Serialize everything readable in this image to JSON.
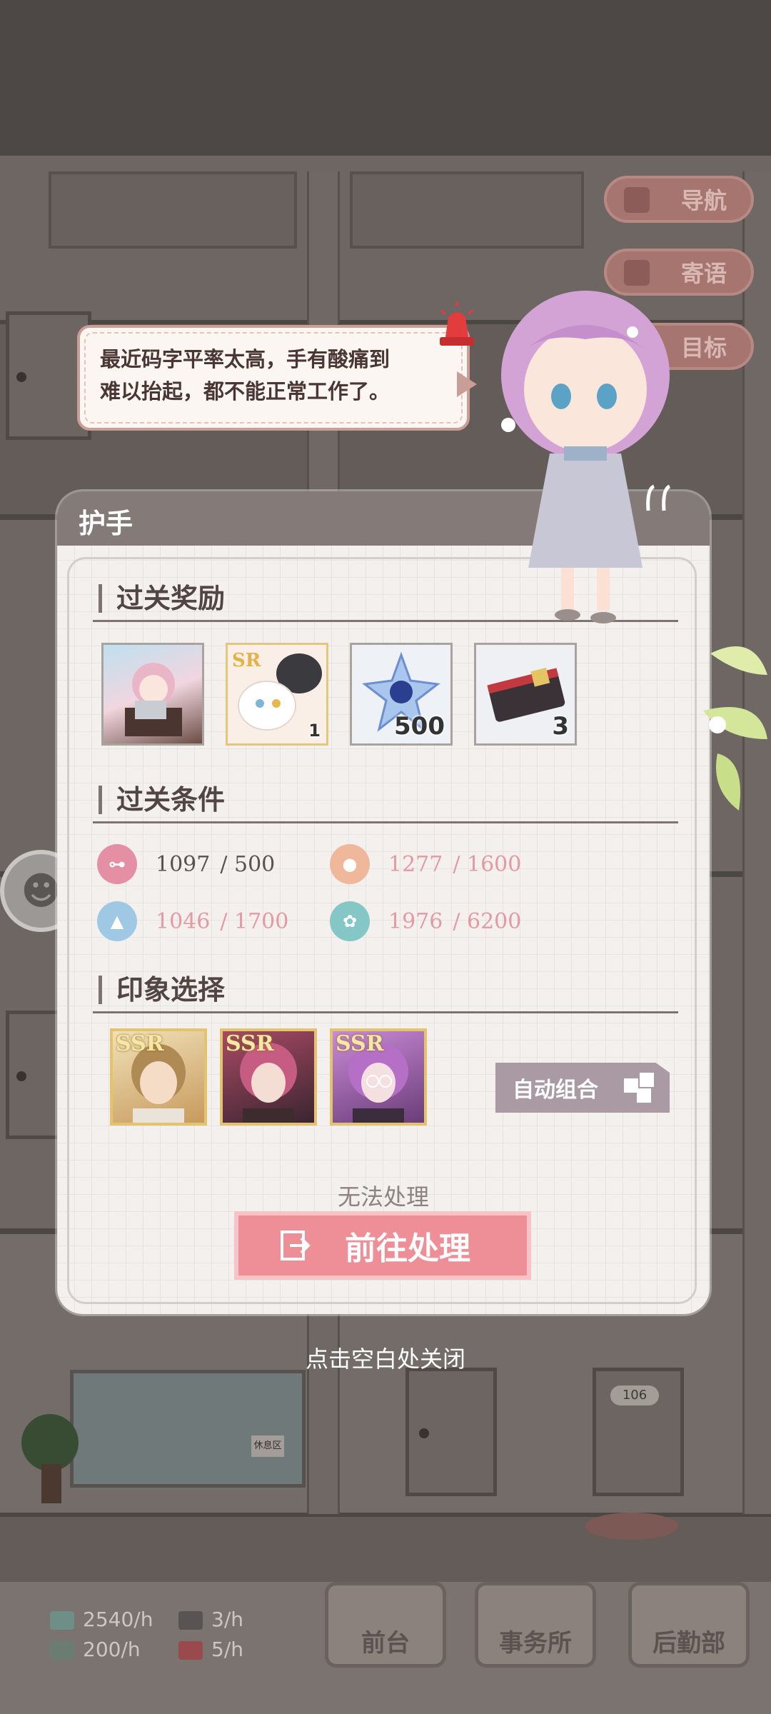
{
  "speech": {
    "line1": "最近码字平率太高，手有酸痛到",
    "line2": "难以抬起，都不能正常工作了。"
  },
  "side_buttons": [
    {
      "label": "导航",
      "icon": "map-icon"
    },
    {
      "label": "寄语",
      "icon": "notebook-icon"
    },
    {
      "label": "目标",
      "icon": "target-icon"
    }
  ],
  "dialog": {
    "title": "护手",
    "rewards_title": "过关奖励",
    "rewards": [
      {
        "name": "scene-card",
        "count": ""
      },
      {
        "name": "sr-cat-card",
        "count": "1"
      },
      {
        "name": "blue-crystal",
        "count": "500"
      },
      {
        "name": "ticket",
        "count": "3"
      }
    ],
    "conditions_title": "过关条件",
    "conditions": [
      {
        "icon": "dumbbell-icon",
        "current": "1097",
        "required": "/ 500",
        "met": true,
        "color": "#e58fa5"
      },
      {
        "icon": "person-icon",
        "current": "1277",
        "required": "/ 1600",
        "met": false,
        "color": "#f0b89b"
      },
      {
        "icon": "graduation-cap-icon",
        "current": "1046",
        "required": "/ 1700",
        "met": false,
        "color": "#9fc8e4"
      },
      {
        "icon": "flower-icon",
        "current": "1976",
        "required": "/ 6200",
        "met": false,
        "color": "#84c7c6"
      }
    ],
    "impression_title": "印象选择",
    "impressions": [
      {
        "rarity": "SSR",
        "name": "blonde-character"
      },
      {
        "rarity": "SSR",
        "name": "red-hair-character"
      },
      {
        "rarity": "SSR",
        "name": "purple-hair-character"
      }
    ],
    "auto_combine": "自动组合",
    "unable_text": "无法处理",
    "go_button": "前往处理"
  },
  "close_hint": "点击空白处关闭",
  "bottom_bar": {
    "stats": [
      {
        "icon": "cash-icon",
        "value": "2540/h"
      },
      {
        "icon": "writer-icon",
        "value": "3/h"
      },
      {
        "icon": "book-icon",
        "value": "200/h"
      },
      {
        "icon": "gift-icon",
        "value": "5/h"
      }
    ],
    "nav": [
      "前台",
      "事务所",
      "后勤部"
    ]
  },
  "scene": {
    "room_number": "106",
    "sign": "休息区"
  }
}
